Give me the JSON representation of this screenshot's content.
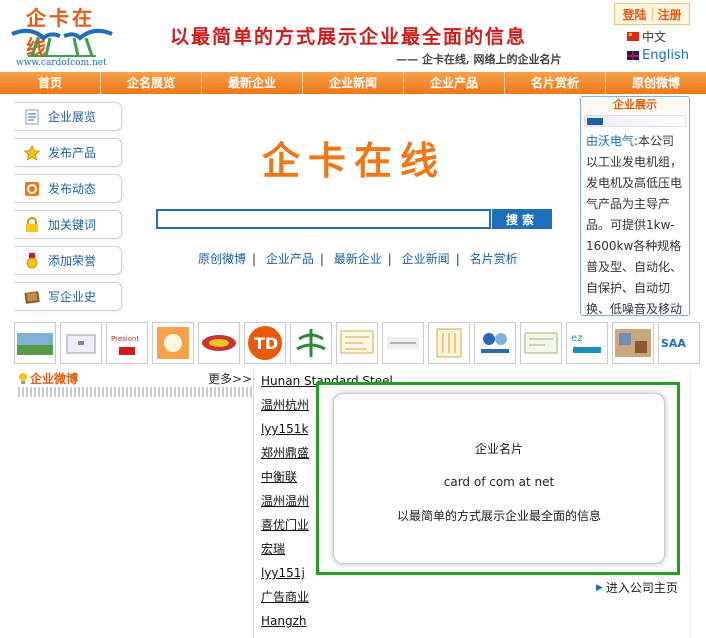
{
  "header": {
    "logo_title": "企卡在线",
    "logo_url": "www.cardofcom.net",
    "slogan": "以最简单的方式展示企业最全面的信息",
    "subslogan": "—— 企卡在线, 网络上的企业名片",
    "login": "登陆",
    "register": "注册",
    "lang_cn": "中文",
    "lang_en": "English"
  },
  "nav": [
    "首页",
    "企名展览",
    "最新企业",
    "企业新闻",
    "企业产品",
    "名片赏析",
    "原创微博"
  ],
  "menu": [
    {
      "label": "企业展览",
      "icon": "document-icon"
    },
    {
      "label": "发布产品",
      "icon": "star-icon"
    },
    {
      "label": "发布动态",
      "icon": "gear-icon"
    },
    {
      "label": "加关键词",
      "icon": "lock-icon"
    },
    {
      "label": "添加荣誉",
      "icon": "medal-icon"
    },
    {
      "label": "写企业史",
      "icon": "book-icon"
    }
  ],
  "search": {
    "brand": "企卡在线",
    "placeholder": "",
    "button": "搜索",
    "quicklinks": [
      "原创微博",
      "企业产品",
      "最新企业",
      "企业新闻",
      "名片赏析"
    ]
  },
  "showcase": {
    "title": "企业展示",
    "company": "由沃电气",
    "text": ":本公司以工业发电机组，发电机及高低压电气产品为主导产品。可提供1kw-1600kw各种规格普及型、自动化、自保护、自动切换、低噪音及移动"
  },
  "logos": [
    "logo-1",
    "logo-2",
    "logo-3",
    "logo-4",
    "logo-5",
    "logo-6",
    "logo-7",
    "logo-8",
    "logo-9",
    "logo-10",
    "logo-11",
    "logo-12",
    "logo-13",
    "logo-14",
    "logo-15"
  ],
  "weibo": {
    "title": "企业微博",
    "more": "更多>>"
  },
  "companies": [
    "Hunan Standard Steel",
    "温州杭州",
    "lyy151k",
    "郑州鼎盛",
    "中衡联",
    "温州温州",
    "喜优门业",
    "宏瑞",
    "lyy151j",
    "广告商业",
    "Hangzh"
  ],
  "card": {
    "line1": "企业名片",
    "line2": "card of com at net",
    "line3": "以最简单的方式展示企业最全面的信息"
  },
  "enter_link": "进入公司主页",
  "colors": {
    "accent": "#ee7716",
    "link": "#1c6fb8",
    "frame": "#22a020",
    "slogan": "#d11a1a"
  }
}
